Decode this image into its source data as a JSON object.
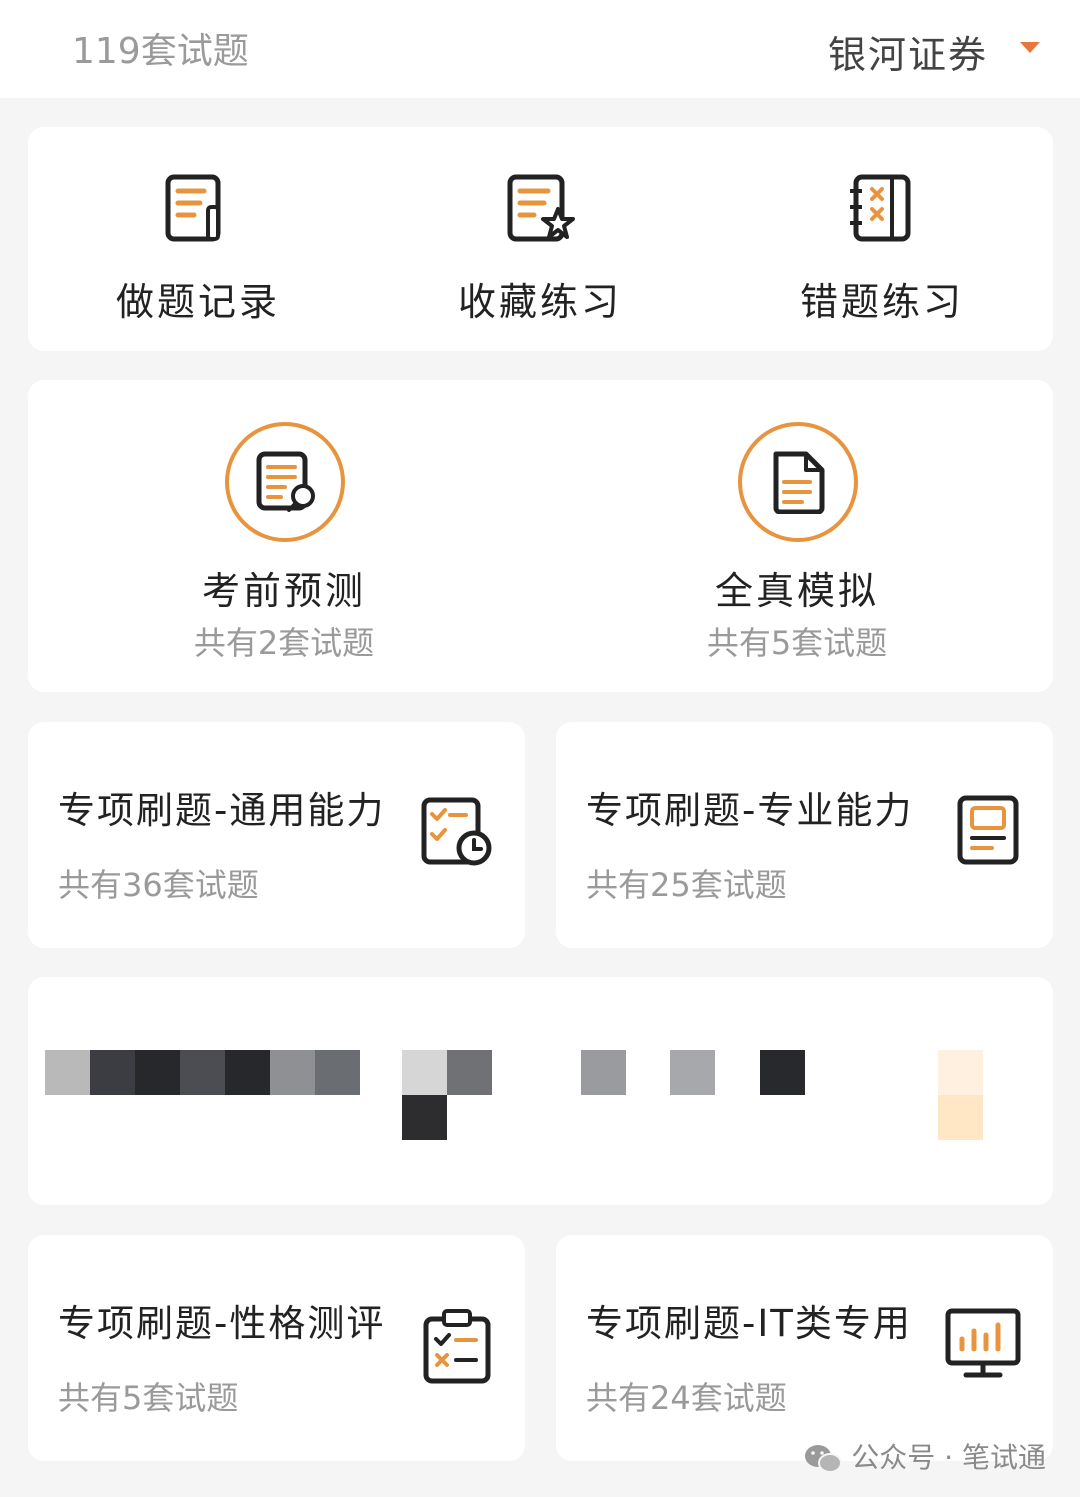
{
  "header": {
    "count_text": "119套试题",
    "company": "银河证券"
  },
  "quick_actions": [
    {
      "label": "做题记录",
      "icon": "record-edit-icon"
    },
    {
      "label": "收藏练习",
      "icon": "favorite-doc-icon"
    },
    {
      "label": "错题练习",
      "icon": "wrong-notebook-icon"
    }
  ],
  "exam_modes": [
    {
      "title": "考前预测",
      "subtitle": "共有2套试题",
      "icon": "doc-search-icon"
    },
    {
      "title": "全真模拟",
      "subtitle": "共有5套试题",
      "icon": "document-icon"
    }
  ],
  "practice": [
    {
      "title": "专项刷题-通用能力",
      "subtitle": "共有36套试题",
      "icon": "checklist-clock-icon"
    },
    {
      "title": "专项刷题-专业能力",
      "subtitle": "共有25套试题",
      "icon": "profile-doc-icon"
    },
    {
      "title": "专项刷题-性格测评",
      "subtitle": "共有5套试题",
      "icon": "clipboard-check-icon"
    },
    {
      "title": "专项刷题-IT类专用",
      "subtitle": "共有24套试题",
      "icon": "monitor-chart-icon"
    }
  ],
  "watermark": "公众号 · 笔试通",
  "colors": {
    "accent": "#e8943f",
    "caret": "#e8773c",
    "text": "#222222",
    "muted": "#9a9a9a",
    "background": "#f5f5f5"
  }
}
